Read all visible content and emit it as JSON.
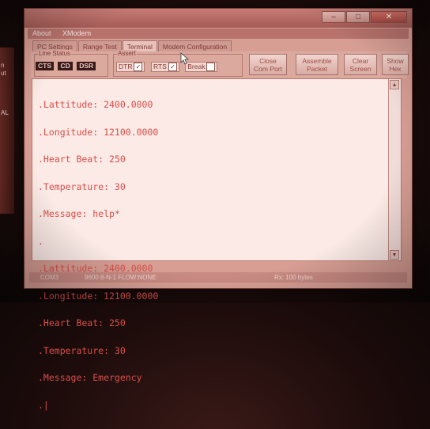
{
  "app": {
    "title": "",
    "title_buttons": [
      "–",
      "□",
      "✕"
    ]
  },
  "menu": {
    "items": [
      "About",
      "XModem"
    ]
  },
  "tabs": [
    {
      "label": "PC Settings"
    },
    {
      "label": "Range Test"
    },
    {
      "label": "Terminal"
    },
    {
      "label": "Modem Configuration"
    }
  ],
  "toolbar": {
    "line_status_label": "Line Status",
    "line_status": [
      "CTS",
      "CD",
      "DSR"
    ],
    "assert_label": "Assert",
    "dtr_label": "DTR",
    "rts_label": "RTS",
    "break_label": "Break",
    "dtr_checked": true,
    "rts_checked": true,
    "break_checked": false,
    "close_com_port": [
      "Close",
      "Com Port"
    ],
    "assemble_packet": [
      "Assemble",
      "Packet"
    ],
    "clear_screen": [
      "Clear",
      "Screen"
    ],
    "show_hex": [
      "Show",
      "Hex"
    ]
  },
  "terminal": {
    "lines": [
      ".Lattitude: 2400.0000",
      ".Longitude: 12100.0000",
      ".Heart Beat: 250",
      ".Temperature: 30",
      ".Message: help*",
      ".",
      ".Lattitude: 2400.0000",
      ".Longitude: 12100.0000",
      ".Heart Beat: 250",
      ".Temperature: 30",
      ".Message: Emergency",
      ".|"
    ]
  },
  "status": {
    "port": "COM3",
    "settings": "9600 8-N-1  FLOW:NONE",
    "rx": "Rx: 100 bytes"
  },
  "desktop": {
    "left_labels": [
      "n",
      "ut",
      "AL"
    ]
  },
  "colors": {
    "terminal_text": "#d84f4a",
    "window_bg": "#d79e94",
    "terminal_bg": "#fbeae6"
  }
}
